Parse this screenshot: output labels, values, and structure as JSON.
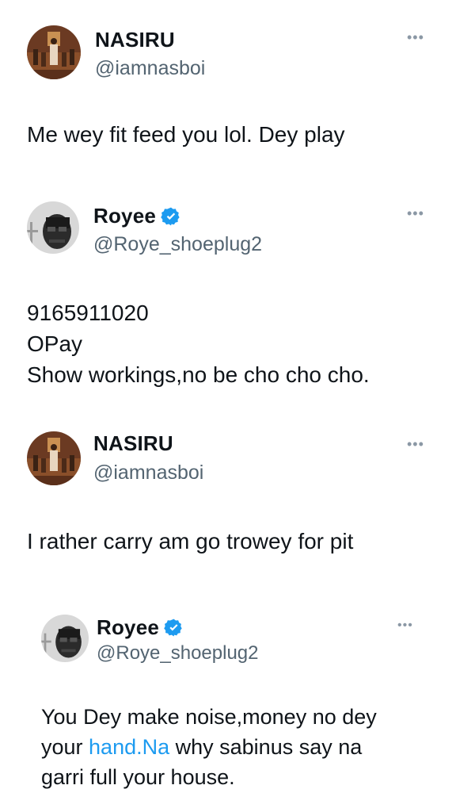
{
  "tweets": [
    {
      "name": "NASIRU",
      "handle": "@iamnasboi",
      "verified": false,
      "lines": [
        "Me wey fit feed you lol. Dey play"
      ]
    },
    {
      "name": "Royee",
      "handle": "@Roye_shoeplug2",
      "verified": true,
      "lines": [
        "9165911020",
        "OPay",
        "Show workings,no be cho cho cho."
      ]
    },
    {
      "name": "NASIRU",
      "handle": "@iamnasboi",
      "verified": false,
      "lines": [
        "I rather carry am go trowey for pit"
      ]
    },
    {
      "name": "Royee",
      "handle": "@Roye_shoeplug2",
      "verified": true,
      "lines": [
        "You Dey make noise,money no dey",
        "your ",
        "hand.Na",
        " why sabinus say na",
        "garri full your house."
      ]
    }
  ],
  "more_glyph": "•••",
  "colors": {
    "verified": "#1d9bf0",
    "link": "#1d9bf0",
    "handle": "#536471"
  },
  "icons": {
    "verified": "verified-badge-icon",
    "more": "more-options-icon"
  }
}
